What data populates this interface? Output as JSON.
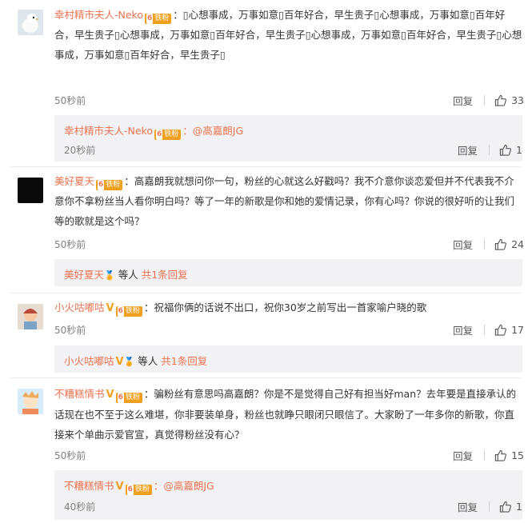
{
  "comments": [
    {
      "user": "幸村精市夫人-Neko",
      "badge": "铁粉",
      "badge_num": "6",
      "text": "：▯心想事成，万事如意▯百年好合，早生贵子▯心想事成，万事如意▯百年好合，早生贵子▯心想事成，万事如意▯百年好合，早生贵子▯心想事成，万事如意▯百年好合，早生贵子▯心想事成，万事如意▯百年好合，早生贵子▯",
      "time": "50秒前",
      "reply_label": "回复",
      "likes": "33",
      "sub": {
        "user": "幸村精市夫人-Neko",
        "badge": "铁粉",
        "badge_num": "6",
        "text": "：@高嘉朗JG",
        "time": "20秒前",
        "reply_label": "回复",
        "likes": "1"
      }
    },
    {
      "user": "美好夏天",
      "badge": "铁粉",
      "badge_num": "6",
      "text": "：高嘉朗我就想问你一句，粉丝的心就这么好戳吗？我不介意你谈恋爱但并不代表我不介意你不拿粉丝当人看你明白吗？等了一年的新歌是你和她的爱情记录，你有心吗？你说的很好听的让我们等的歌就是这个吗？",
      "time": "50秒前",
      "reply_label": "回复",
      "likes": "24",
      "sub": {
        "user": "美好夏天",
        "text": "等人",
        "count_text": "共1条回复"
      }
    },
    {
      "user": "小火咕嘟咕",
      "badge": "铁粉",
      "badge_num": "6",
      "text": "：祝福你俩的话说不出口，祝你30岁之前写出一首家喻户晓的歌",
      "time": "50秒前",
      "reply_label": "回复",
      "likes": "17",
      "sub": {
        "user": "小火咕嘟咕",
        "text": "等人",
        "count_text": "共1条回复"
      }
    },
    {
      "user": "不糟糕情书",
      "badge": "铁粉",
      "badge_num": "6",
      "text": "：骗粉丝有意思吗高嘉朗？你是不是觉得自己好有担当好man？去年要是直接承认的话现在也不至于这么难堪，你非要装单身，粉丝也就睁只眼闭只眼信了。大家盼了一年多你的新歌，你直接来个单曲示爱官宣，真觉得粉丝没有心？",
      "time": "50秒前",
      "reply_label": "回复",
      "likes": "15",
      "sub": {
        "user": "不糟糕情书",
        "badge": "铁粉",
        "badge_num": "6",
        "text": "：@高嘉朗JG",
        "time": "40秒前",
        "reply_label": "回复",
        "likes": "1"
      }
    }
  ],
  "icons": {
    "like": "thumb-up-icon",
    "verified": "v-verified-icon"
  },
  "colors": {
    "username": "#eb7350",
    "badge": "#f0a01f",
    "meta": "#808080",
    "reply_bg": "#f2f2f5"
  }
}
